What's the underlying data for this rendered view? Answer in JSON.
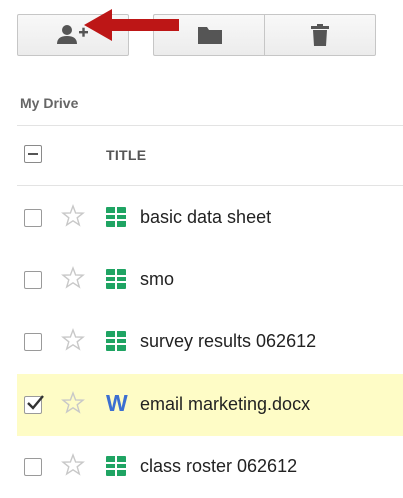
{
  "toolbar": {
    "share_icon": "add-person-icon",
    "folder_icon": "folder-icon",
    "delete_icon": "trash-icon",
    "annotation": "red-arrow-pointer",
    "arrow_color": "#bd1616"
  },
  "breadcrumb": "My Drive",
  "list": {
    "column_title": "TITLE",
    "files": [
      {
        "name": "basic data sheet",
        "type": "spreadsheet",
        "checked": false,
        "starred": false
      },
      {
        "name": "smo",
        "type": "spreadsheet",
        "checked": false,
        "starred": false
      },
      {
        "name": "survey results 062612",
        "type": "spreadsheet",
        "checked": false,
        "starred": false
      },
      {
        "name": "email marketing.docx",
        "type": "word",
        "icon_letter": "W",
        "checked": true,
        "starred": false
      },
      {
        "name": "class roster 062612",
        "type": "spreadsheet",
        "checked": false,
        "starred": false
      }
    ]
  },
  "colors": {
    "selected_row": "#fefcc6",
    "sheet_green": "#1fa463",
    "word_blue": "#3c6fd1"
  }
}
